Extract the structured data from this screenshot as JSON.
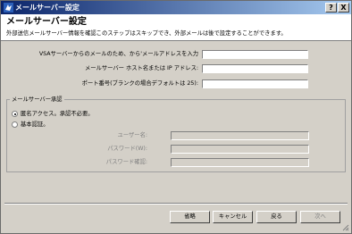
{
  "titlebar": {
    "title": "メールサーバー設定",
    "help_label": "?",
    "close_label": "X"
  },
  "header": {
    "heading": "メールサーバー設定",
    "description": "外部送信メールサーバー情報を確認このステップはスキップでき、外部メールは後で設定することができます。"
  },
  "form": {
    "vsa_email": {
      "label": "VSAサーバーからのメールのため、から'メールアドレスを入力",
      "value": ""
    },
    "host": {
      "label": "メールサーバー ホスト名または IP アドレス:",
      "value": ""
    },
    "port": {
      "label": "ポート番号(ブランクの場合デフォルトは 25):",
      "value": ""
    }
  },
  "auth": {
    "legend": "メールサーバー承認",
    "anonymous_label": "匿名アクセス。承認不必要。",
    "basic_label": "基本認証。",
    "selected": "anonymous",
    "username_label": "ユーザー名:",
    "password_label": "パスワード(W):",
    "confirm_label": "パスワード確認:"
  },
  "buttons": {
    "skip": "省略",
    "cancel": "キャンセル",
    "back": "戻る",
    "next": "次へ"
  }
}
